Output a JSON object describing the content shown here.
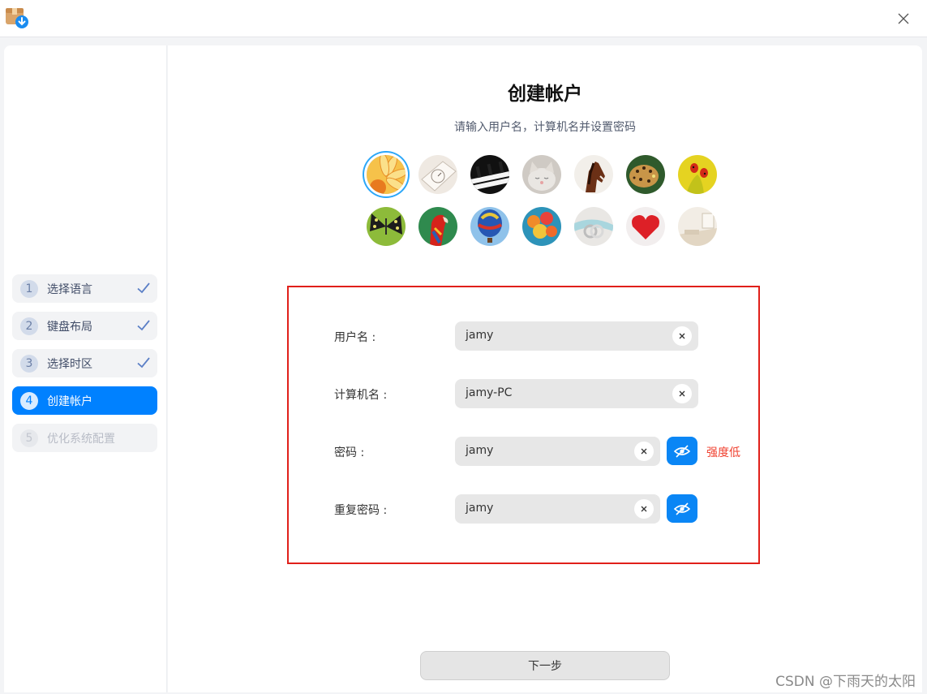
{
  "titlebar": {
    "app_icon": "installer-package-icon",
    "close_icon": "close-icon"
  },
  "sidebar": {
    "steps": [
      {
        "num": "1",
        "label": "选择语言",
        "state": "done"
      },
      {
        "num": "2",
        "label": "键盘布局",
        "state": "done"
      },
      {
        "num": "3",
        "label": "选择时区",
        "state": "done"
      },
      {
        "num": "4",
        "label": "创建帐户",
        "state": "active"
      },
      {
        "num": "5",
        "label": "优化系统配置",
        "state": "disabled"
      }
    ]
  },
  "main": {
    "title": "创建帐户",
    "subtitle": "请输入用户名，计算机名并设置密码",
    "avatars": [
      "flower",
      "clock-paper",
      "piano",
      "kitten",
      "horse",
      "leopard",
      "ladybug",
      "butterfly",
      "parrot",
      "hot-air-balloon",
      "balloons",
      "rings",
      "heart",
      "room"
    ],
    "selected_avatar": "flower",
    "form": {
      "username": {
        "label": "用户名 :",
        "value": "jamy"
      },
      "computer_name": {
        "label": "计算机名 :",
        "value": "jamy-PC"
      },
      "password": {
        "label": "密码 :",
        "value": "jamy",
        "strength": "强度低"
      },
      "repeat_password": {
        "label": "重复密码 :",
        "value": "jamy"
      }
    },
    "next_button": "下一步"
  },
  "watermark": "CSDN @下雨天的太阳",
  "colors": {
    "accent": "#0081ff",
    "highlight_border": "#e0201a",
    "strength_low": "#f0402f"
  }
}
